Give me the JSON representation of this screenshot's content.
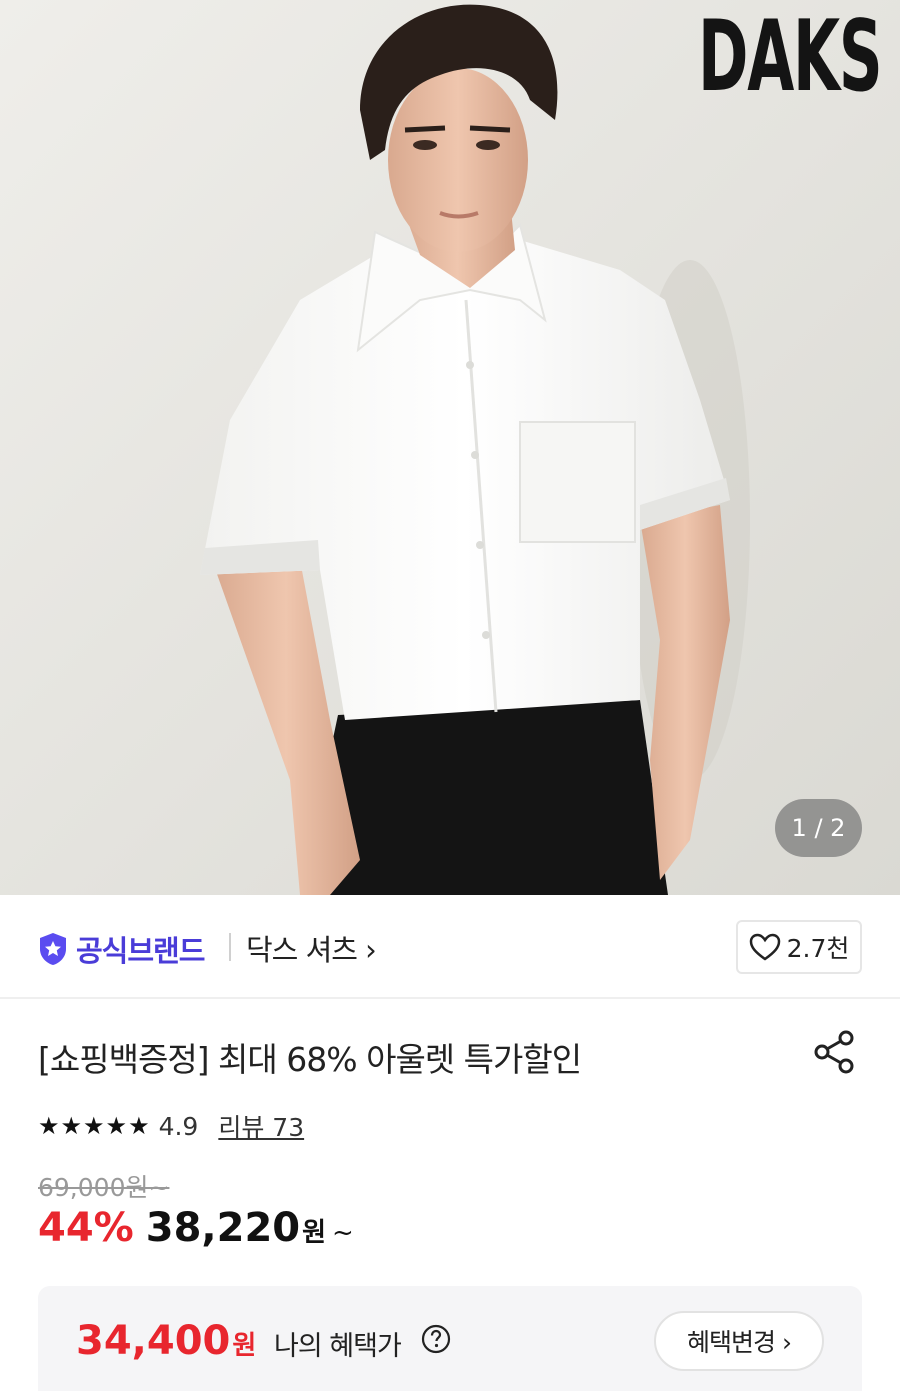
{
  "hero": {
    "brand_logo": "DAKS",
    "pager": "1 / 2",
    "icons": [
      "model-photo"
    ]
  },
  "brand_row": {
    "official_label": "공식브랜드",
    "brand_link": "닥스 셔츠 ›",
    "like_count": "2.7천",
    "icons": [
      "shield-star-icon",
      "heart-icon"
    ],
    "colors": {
      "official": "#4a3cd8"
    }
  },
  "product": {
    "title": "[쇼핑백증정] 최대 68% 아울렛 특가할인",
    "stars": "★★★★★",
    "rating": "4.9",
    "reviews": "리뷰 73",
    "original_price": "69,000원~",
    "discount": "44%",
    "sale_price": "38,220",
    "sale_won": "원",
    "tilde": "~",
    "icons": [
      "share-icon"
    ],
    "colors": {
      "discount": "#e8262e"
    }
  },
  "benefit": {
    "price": "34,400",
    "won": "원",
    "label": "나의 혜택가",
    "button": "혜택변경 ›",
    "icons": [
      "question-circle-icon"
    ]
  }
}
